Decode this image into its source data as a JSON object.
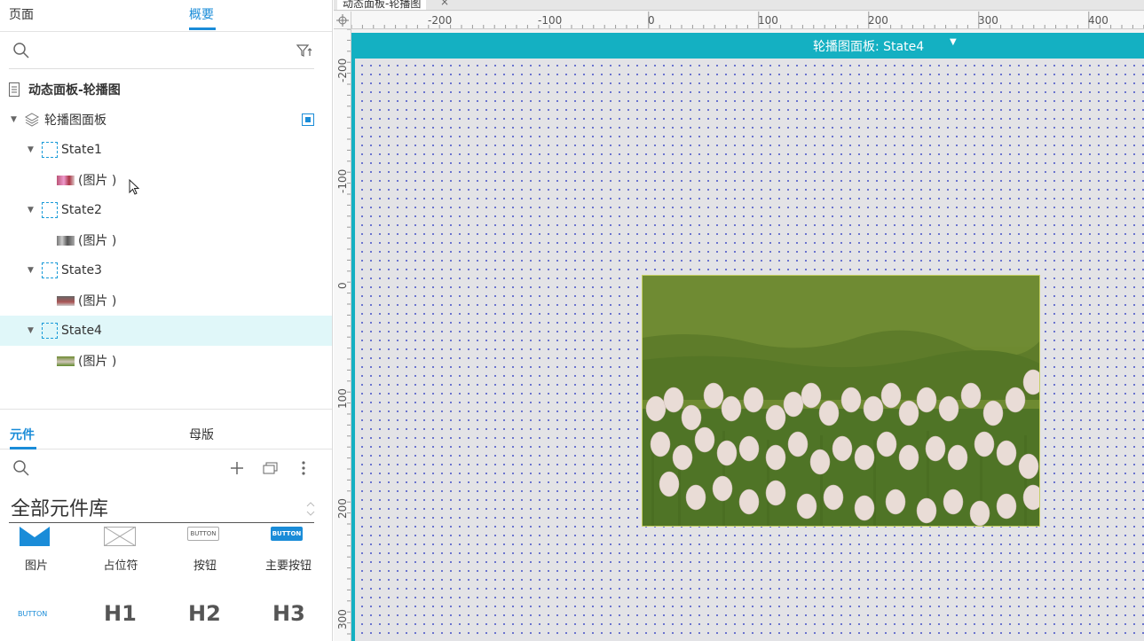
{
  "left_panel": {
    "top_tabs": {
      "pages": "页面",
      "outline": "概要"
    },
    "tree": {
      "page_title": "动态面板-轮播图",
      "panel_name": "轮播图面板",
      "states": [
        {
          "name": "State1",
          "child": "(图片 )"
        },
        {
          "name": "State2",
          "child": "(图片 )"
        },
        {
          "name": "State3",
          "child": "(图片 )"
        },
        {
          "name": "State4",
          "child": "(图片 )"
        }
      ]
    },
    "mid_tabs": {
      "widgets": "元件",
      "masters": "母版"
    },
    "library": {
      "title": "全部元件库",
      "widgets": [
        {
          "label": "图片"
        },
        {
          "label": "占位符"
        },
        {
          "label": "按钮",
          "preview": "BUTTON"
        },
        {
          "label": "主要按钮",
          "preview": "BUTTON"
        }
      ],
      "widgets_row2": [
        {
          "preview": "BUTTON"
        },
        {
          "preview": "H1"
        },
        {
          "preview": "H2"
        },
        {
          "preview": "H3"
        }
      ]
    }
  },
  "canvas": {
    "doc_tab": "动态面板-轮播图",
    "ruler_top": [
      "-200",
      "-100",
      "0",
      "100",
      "200",
      "300",
      "400"
    ],
    "ruler_left": [
      "-200",
      "-100",
      "0",
      "100",
      "200",
      "300"
    ],
    "panel_header": "轮播图面板: State4",
    "colors": {
      "accent": "#14b0c2",
      "tab_active": "#1a8cd8"
    }
  }
}
